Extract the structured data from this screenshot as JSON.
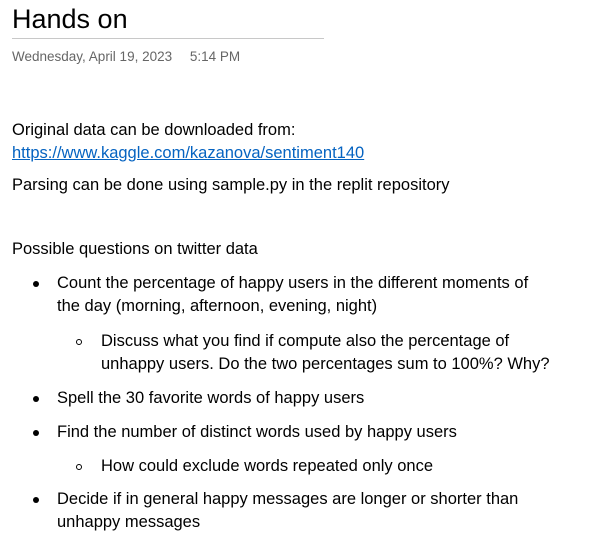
{
  "page": {
    "title": "Hands on",
    "date": "Wednesday, April 19, 2023",
    "time": "5:14 PM"
  },
  "intro": {
    "source_label": "Original data can be downloaded from:",
    "source_link": "https://www.kaggle.com/kazanova/sentiment140",
    "parsing_note": "Parsing can be done using sample.py in the replit repository"
  },
  "questions": {
    "heading": "Possible questions on twitter data",
    "q1_line1": "Count the percentage of happy users in the different moments of",
    "q1_line2": "the day (morning, afternoon, evening, night)",
    "q1_sub_line1": "Discuss what you find if compute also the percentage of",
    "q1_sub_line2": "unhappy users. Do the two percentages sum to 100%? Why?",
    "q2": "Spell the 30 favorite words of happy users",
    "q3": "Find the number of distinct words used by happy users",
    "q3_sub": "How could exclude words repeated only once",
    "q4_line1": "Decide if in general happy messages are longer or shorter than",
    "q4_line2": "unhappy messages"
  }
}
